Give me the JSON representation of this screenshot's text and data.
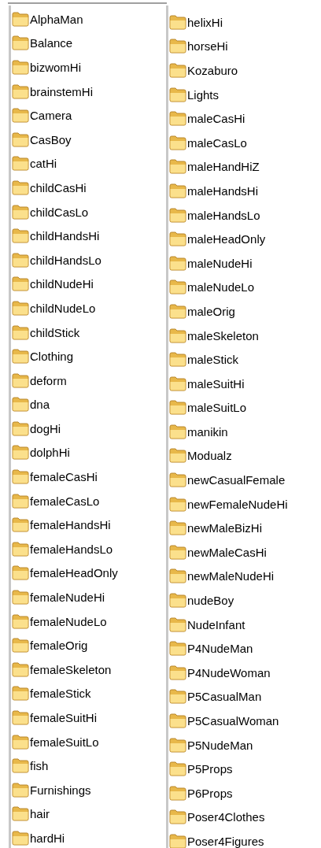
{
  "columns": [
    {
      "items": [
        "AlphaMan",
        "Balance",
        "bizwomHi",
        "brainstemHi",
        "Camera",
        "CasBoy",
        "catHi",
        "childCasHi",
        "childCasLo",
        "childHandsHi",
        "childHandsLo",
        "childNudeHi",
        "childNudeLo",
        "childStick",
        "Clothing",
        "deform",
        "dna",
        "dogHi",
        "dolphHi",
        "femaleCasHi",
        "femaleCasLo",
        "femaleHandsHi",
        "femaleHandsLo",
        "femaleHeadOnly",
        "femaleNudeHi",
        "femaleNudeLo",
        "femaleOrig",
        "femaleSkeleton",
        "femaleStick",
        "femaleSuitHi",
        "femaleSuitLo",
        "fish",
        "Furnishings",
        "hair",
        "hardHi"
      ]
    },
    {
      "items": [
        "helixHi",
        "horseHi",
        "Kozaburo",
        "Lights",
        "maleCasHi",
        "maleCasLo",
        "maleHandHiZ",
        "maleHandsHi",
        "maleHandsLo",
        "maleHeadOnly",
        "maleNudeHi",
        "maleNudeLo",
        "maleOrig",
        "maleSkeleton",
        "maleStick",
        "maleSuitHi",
        "maleSuitLo",
        "manikin",
        "Modualz",
        "newCasualFemale",
        "newFemaleNudeHi",
        "newMaleBizHi",
        "newMaleCasHi",
        "newMaleNudeHi",
        "nudeBoy",
        "NudeInfant",
        "P4NudeMan",
        "P4NudeWoman",
        "P5CasualMan",
        "P5CasualWoman",
        "P5NudeMan",
        "P5Props",
        "P6Props",
        "Poser4Clothes",
        "Poser4Figures"
      ]
    }
  ]
}
